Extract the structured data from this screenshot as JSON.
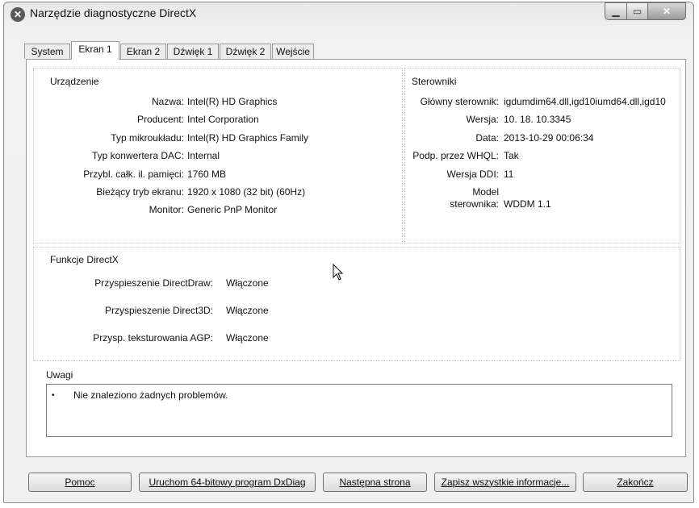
{
  "window": {
    "title": "Narzędzie diagnostyczne DirectX"
  },
  "tabs": [
    {
      "label": "System"
    },
    {
      "label": "Ekran 1"
    },
    {
      "label": "Ekran 2"
    },
    {
      "label": "Dźwięk 1"
    },
    {
      "label": "Dźwięk 2"
    },
    {
      "label": "Wejście"
    }
  ],
  "device": {
    "title": "Urządzenie",
    "rows": [
      {
        "label": "Nazwa:",
        "value": "Intel(R) HD Graphics"
      },
      {
        "label": "Producent:",
        "value": "Intel Corporation"
      },
      {
        "label": "Typ mikroukładu:",
        "value": "Intel(R) HD Graphics Family"
      },
      {
        "label": "Typ konwertera DAC:",
        "value": "Internal"
      },
      {
        "label": "Przybl. całk. il. pamięci:",
        "value": "1760 MB"
      },
      {
        "label": "Bieżący tryb ekranu:",
        "value": "1920 x 1080 (32 bit) (60Hz)"
      },
      {
        "label": "Monitor:",
        "value": "Generic PnP Monitor"
      }
    ]
  },
  "drivers": {
    "title": "Sterowniki",
    "rows": [
      {
        "label": "Główny sterownik:",
        "value": "igdumdim64.dll,igd10iumd64.dll,igd10"
      },
      {
        "label": "Wersja:",
        "value": "10. 18. 10.3345"
      },
      {
        "label": "Data:",
        "value": "2013-10-29 00:06:34"
      },
      {
        "label": "Podp. przez WHQL:",
        "value": "Tak"
      },
      {
        "label": "Wersja DDI:",
        "value": "11"
      },
      {
        "label": "Model",
        "value": ""
      },
      {
        "label": "sterownika:",
        "value": "WDDM 1.1"
      }
    ]
  },
  "directx": {
    "title": "Funkcje DirectX",
    "rows": [
      {
        "label": "Przyspieszenie DirectDraw:",
        "value": "Włączone"
      },
      {
        "label": "Przyspieszenie Direct3D:",
        "value": "Włączone"
      },
      {
        "label": "Przysp. teksturowania AGP:",
        "value": "Włączone"
      }
    ]
  },
  "notes": {
    "title": "Uwagi",
    "items": [
      "Nie znaleziono żadnych problemów."
    ]
  },
  "buttons": {
    "help": "Pomoc",
    "run64": "Uruchom 64-bitowy program DxDiag",
    "next": "Następna strona",
    "save": "Zapisz wszystkie informacje...",
    "exit": "Zakończ"
  }
}
